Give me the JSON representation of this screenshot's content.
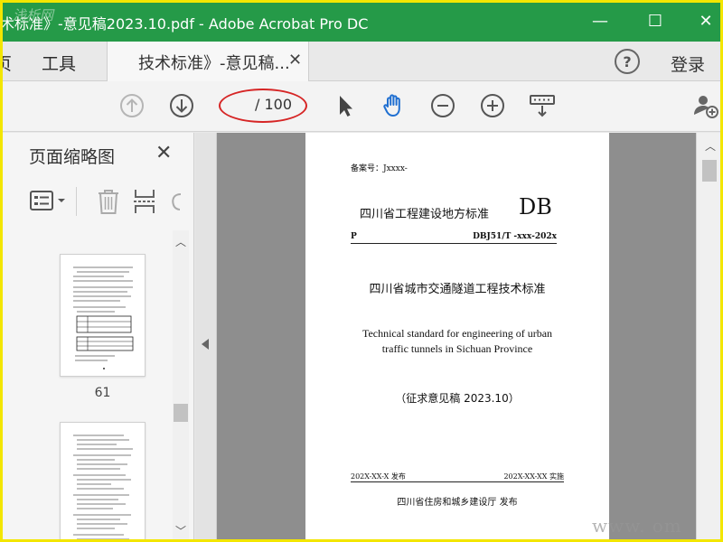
{
  "window": {
    "title": "术标准》-意见稿2023.10.pdf - Adobe Acrobat Pro DC",
    "controls": {
      "minimize": "—",
      "maximize": "☐",
      "close": "✕"
    }
  },
  "tabbar": {
    "partial_left": "页",
    "tools": "工具",
    "active_tab": "技术标准》-意见稿...",
    "tab_close": "✕",
    "help": "?",
    "login": "登录"
  },
  "toolbar": {
    "current_page": "",
    "page_total": "/ 100",
    "icons": [
      "prev-page-icon",
      "next-page-icon",
      "select-pointer-icon",
      "hand-tool-icon",
      "zoom-out-icon",
      "zoom-in-icon",
      "scroll-mode-icon",
      "share-user-icon"
    ],
    "hand_color": "#1f6fd1"
  },
  "sidebar": {
    "title": "页面缩略图",
    "close": "✕",
    "thumbnails": [
      {
        "label": "61"
      },
      {
        "label": ""
      }
    ]
  },
  "document": {
    "record_no": "备案号：Jxxxx-",
    "std_type": "四川省工程建设地方标准",
    "db": "DB",
    "p": "P",
    "code": "DBJ51/T -xxx-202x",
    "title_cn": "四川省城市交通隧道工程技术标准",
    "title_en_line1": "Technical standard for engineering of urban",
    "title_en_line2": "traffic tunnels in Sichuan Province",
    "draft": "（征求意见稿 2023.10）",
    "publish_date": "202X-XX-X 发布",
    "implement_date": "202X-XX-XX 实施",
    "issuer": "四川省住房和城乡建设厅      发布"
  },
  "watermarks": {
    "top": "浅析网",
    "bottom": "www.         om"
  },
  "colors": {
    "titlebar": "#259a48",
    "highlight_oval": "#d62525",
    "frame": "#f3e600"
  }
}
